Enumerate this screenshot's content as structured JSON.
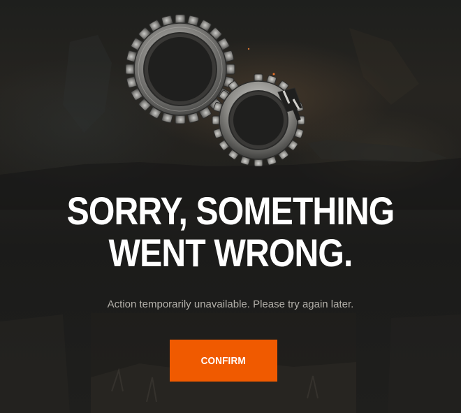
{
  "dialog": {
    "headline_line1": "SORRY, SOMETHING",
    "headline_line2": "WENT WRONG.",
    "message": "Action temporarily unavailable. Please try again later.",
    "confirm_label": "CONFIRM"
  },
  "icons": {
    "illustration": "broken-gears-icon"
  },
  "colors": {
    "accent": "#f05a00",
    "headline": "#ffffff",
    "message": "#b3b0aa",
    "background": "#1a1a1a"
  }
}
